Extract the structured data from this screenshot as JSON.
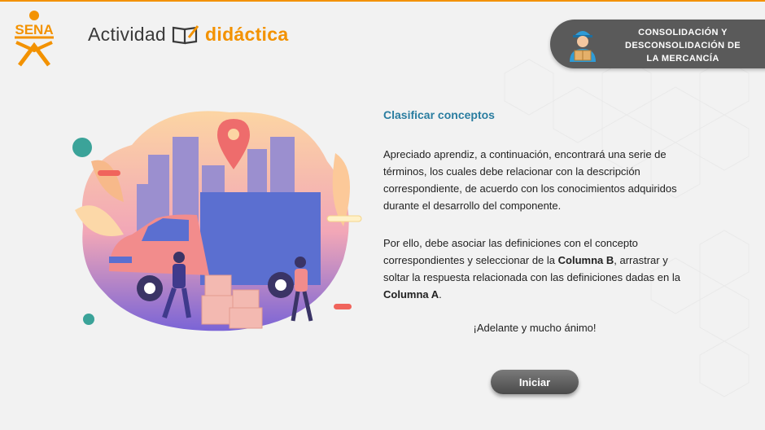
{
  "header": {
    "logo_text": "SENA",
    "title_part1": "Actividad",
    "title_part2": "didáctica",
    "topic_lines": [
      "CONSOLIDACIÓN Y",
      "DESCONSOLIDACIÓN DE",
      "LA MERCANCÍA"
    ]
  },
  "content": {
    "title": "Clasificar conceptos",
    "paragraph1": "Apreciado aprendiz, a continuación, encontrará una serie de términos, los cuales debe relacionar con la descripción correspondiente, de acuerdo con los conocimientos adquiridos durante el desarrollo del componente.",
    "paragraph2_part1": "Por ello, debe asociar las definiciones con el concepto correspondientes y seleccionar de la ",
    "paragraph2_bold1": "Columna B",
    "paragraph2_part2": ", arrastrar y soltar la respuesta relacionada con las definiciones dadas en la ",
    "paragraph2_bold2": "Columna A",
    "paragraph2_part3": ".",
    "closing": "¡Adelante y mucho ánimo!",
    "start_button": "Iniciar"
  },
  "colors": {
    "accent_orange": "#f39200",
    "title_blue": "#2a7da0",
    "badge_gray": "#5a5a5a",
    "button_gray": "#5e5e5e"
  },
  "icons": [
    "sena-logo",
    "book-pencil-icon",
    "delivery-worker-icon",
    "location-pin-icon"
  ]
}
